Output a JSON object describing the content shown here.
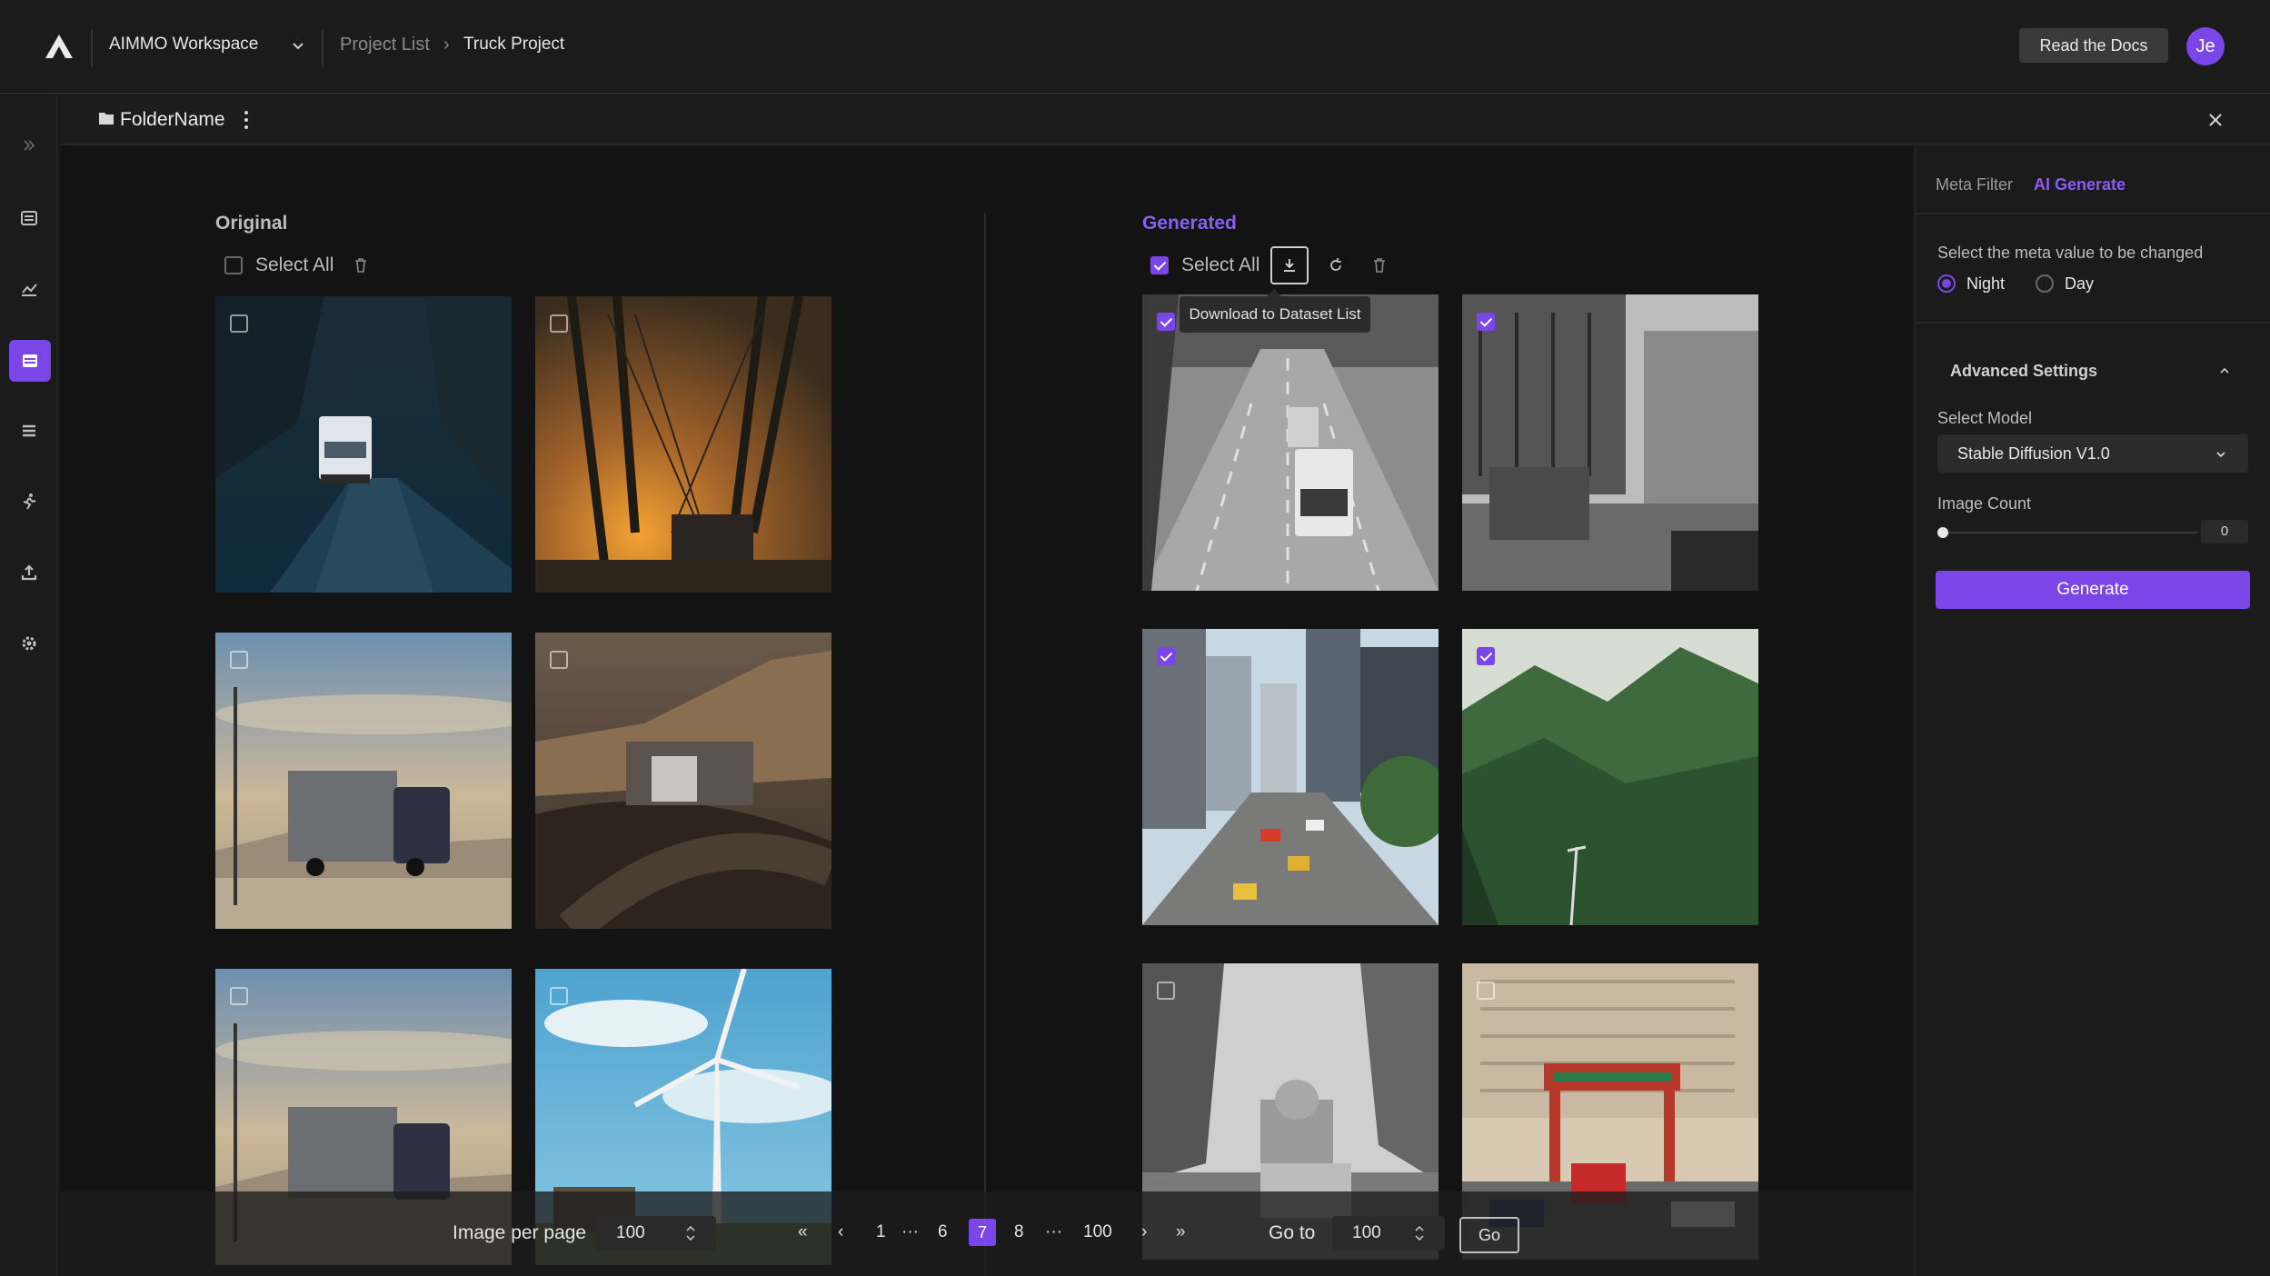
{
  "header": {
    "workspace": "AIMMO Workspace",
    "breadcrumb": [
      "Project List",
      "Truck Project"
    ],
    "breadcrumb_sep": "›",
    "docs_button": "Read the Docs",
    "avatar_initials": "Je"
  },
  "folder": {
    "name": "FolderName"
  },
  "original": {
    "title": "Original",
    "select_all": "Select All",
    "images": [
      {
        "name": "truck-mountain-road",
        "checked": false
      },
      {
        "name": "bridge-sunset-truck",
        "checked": false
      },
      {
        "name": "truck-desert-sky",
        "checked": false
      },
      {
        "name": "truck-desert-road",
        "checked": false
      },
      {
        "name": "truck-desert-sky-2",
        "checked": false
      },
      {
        "name": "wind-turbine-truck",
        "checked": false
      }
    ]
  },
  "generated": {
    "title": "Generated",
    "select_all": "Select All",
    "tooltip": "Download  to Dataset List",
    "images": [
      {
        "name": "highway-trucks-bw",
        "checked": true
      },
      {
        "name": "street-bw",
        "checked": true
      },
      {
        "name": "city-street",
        "checked": true
      },
      {
        "name": "green-mountain",
        "checked": true
      },
      {
        "name": "capitol-bw",
        "checked": false
      },
      {
        "name": "chinatown-gate",
        "checked": false
      }
    ]
  },
  "pagination": {
    "per_page_label": "Image per page",
    "per_page_value": "100",
    "first": "«",
    "prev": "‹",
    "next": "›",
    "last": "»",
    "ellipsis": "···",
    "pages": [
      "1",
      "6",
      "7",
      "8",
      "100"
    ],
    "current": "7",
    "goto_label": "Go to",
    "goto_value": "100",
    "go_button": "Go"
  },
  "panel": {
    "tabs": [
      "Meta Filter",
      "AI Generate"
    ],
    "active_tab": "AI Generate",
    "meta_prompt": "Select the meta value to be changed",
    "options": [
      "Night",
      "Day"
    ],
    "selected_option": "Night",
    "advanced_title": "Advanced Settings",
    "model_label": "Select Model",
    "model_value": "Stable Diffusion V1.0",
    "count_label": "Image Count",
    "count_value": "0",
    "generate_button": "Generate"
  },
  "colors": {
    "accent": "#7b46e8",
    "background": "#131313",
    "panel": "#1b1b1b"
  },
  "icons": [
    "logo-icon",
    "chevron-down-icon",
    "expand-icon",
    "list-icon",
    "chart-icon",
    "dataset-icon",
    "menu-icon",
    "run-icon",
    "upload-icon",
    "gear-icon",
    "folder-icon",
    "kebab-icon",
    "close-icon",
    "trash-icon",
    "download-icon",
    "refresh-icon",
    "chevron-up-icon"
  ]
}
